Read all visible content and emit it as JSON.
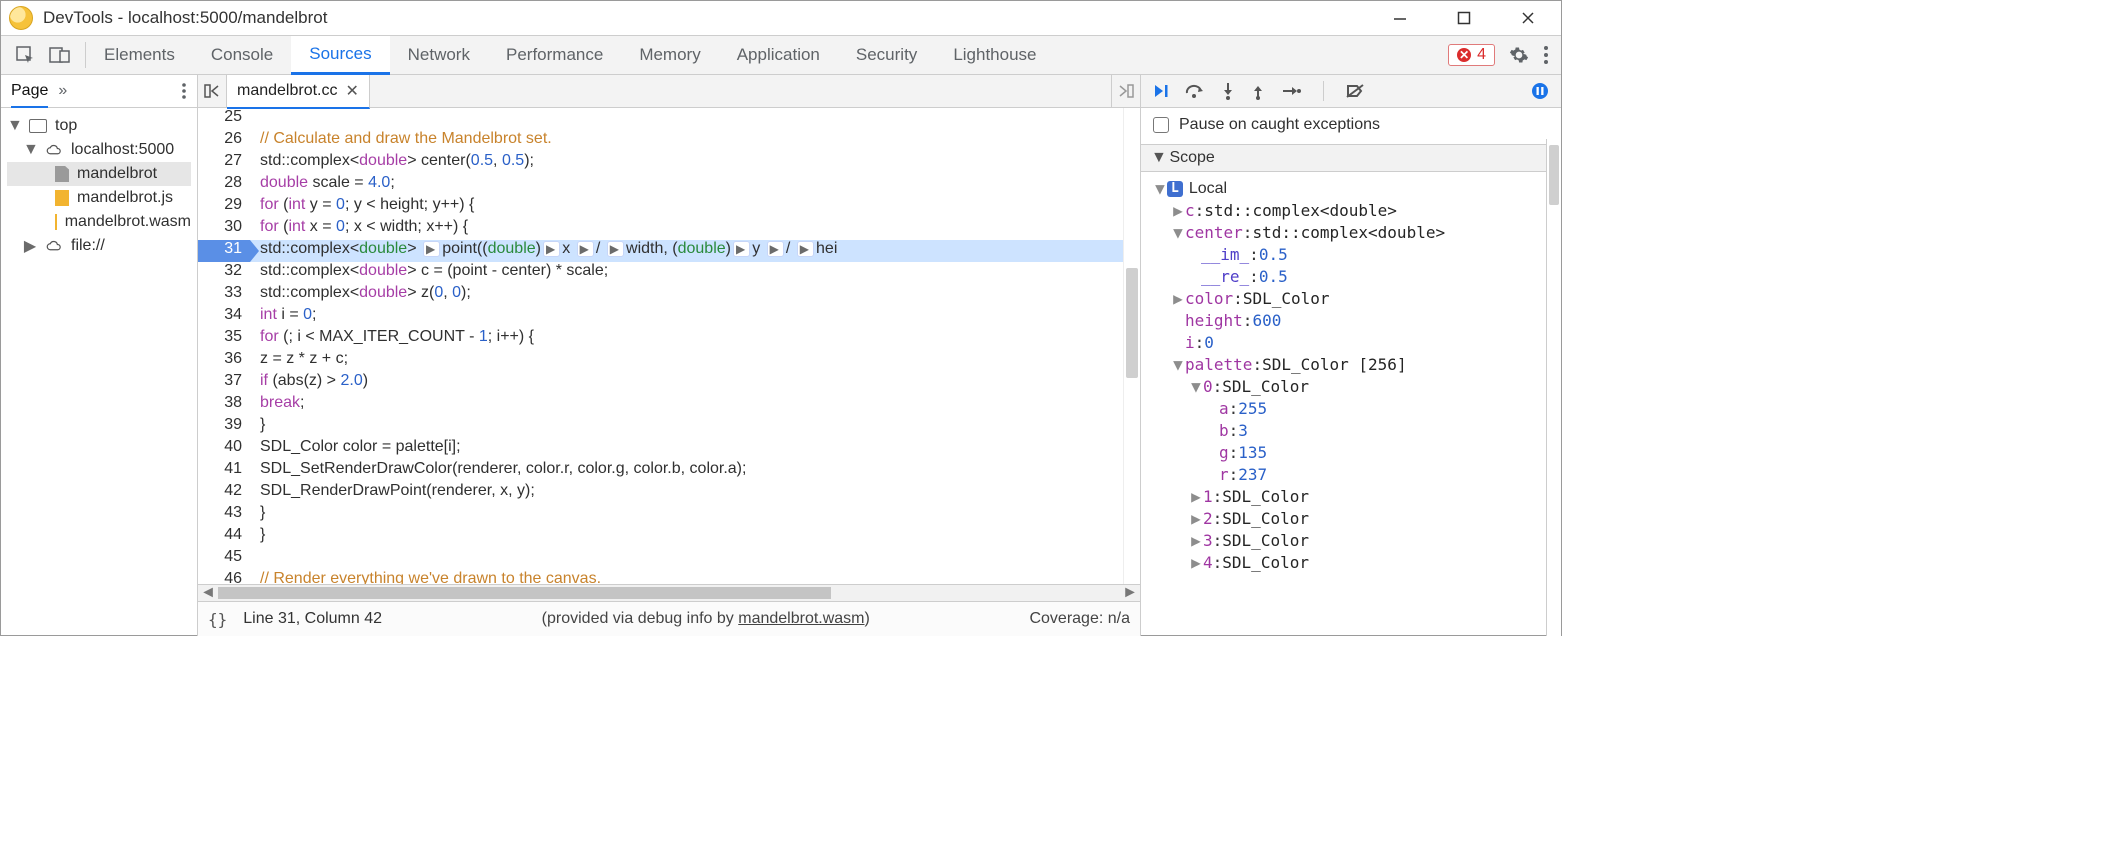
{
  "window": {
    "title": "DevTools - localhost:5000/mandelbrot"
  },
  "mainTabs": {
    "items": [
      "Elements",
      "Console",
      "Sources",
      "Network",
      "Performance",
      "Memory",
      "Application",
      "Security",
      "Lighthouse"
    ],
    "active": "Sources",
    "errorCount": "4"
  },
  "sidebar": {
    "section": "Page",
    "moreGlyph": "»",
    "tree": {
      "top": "top",
      "host": "localhost:5000",
      "files": [
        "mandelbrot",
        "mandelbrot.js",
        "mandelbrot.wasm"
      ],
      "fileScheme": "file://"
    }
  },
  "editor": {
    "tabName": "mandelbrot.cc",
    "startLine": 25,
    "highlightLine": 31,
    "lines": {
      "25": "",
      "26": "  // Calculate and draw the Mandelbrot set.",
      "27": "  std::complex<double> center(0.5, 0.5);",
      "28": "  double scale = 4.0;",
      "29": "  for (int y = 0; y < height; y++) {",
      "30": "    for (int x = 0; x < width; x++) {",
      "31": "      std::complex<double> point((double)x / width, (double)y / hei",
      "32": "      std::complex<double> c = (point - center) * scale;",
      "33": "      std::complex<double> z(0, 0);",
      "34": "      int i = 0;",
      "35": "      for (; i < MAX_ITER_COUNT - 1; i++) {",
      "36": "        z = z * z + c;",
      "37": "        if (abs(z) > 2.0)",
      "38": "          break;",
      "39": "      }",
      "40": "      SDL_Color color = palette[i];",
      "41": "      SDL_SetRenderDrawColor(renderer, color.r, color.g, color.b, color.a);",
      "42": "      SDL_RenderDrawPoint(renderer, x, y);",
      "43": "    }",
      "44": "  }",
      "45": "",
      "46": "  // Render everything we've drawn to the canvas.",
      "47": ""
    }
  },
  "status": {
    "pos": "Line 31, Column 42",
    "debugPrefix": "(provided via debug info by ",
    "debugLink": "mandelbrot.wasm",
    "debugSuffix": ")",
    "coverage": "Coverage: n/a"
  },
  "debug": {
    "pauseCaught": "Pause on caught exceptions",
    "scopeTitle": "Scope",
    "localTitle": "Local",
    "vars": {
      "c": {
        "name": "c",
        "type": "std::complex<double>"
      },
      "center": {
        "name": "center",
        "type": "std::complex<double>",
        "im": {
          "k": "__im_",
          "v": "0.5"
        },
        "re": {
          "k": "__re_",
          "v": "0.5"
        }
      },
      "color": {
        "name": "color",
        "type": "SDL_Color"
      },
      "height": {
        "name": "height",
        "value": "600"
      },
      "i": {
        "name": "i",
        "value": "0"
      },
      "palette": {
        "name": "palette",
        "type": "SDL_Color [256]",
        "entry0": {
          "idx": "0",
          "type": "SDL_Color",
          "a": {
            "k": "a",
            "v": "255"
          },
          "b": {
            "k": "b",
            "v": "3"
          },
          "g": {
            "k": "g",
            "v": "135"
          },
          "r": {
            "k": "r",
            "v": "237"
          }
        },
        "rest": [
          {
            "idx": "1",
            "type": "SDL_Color"
          },
          {
            "idx": "2",
            "type": "SDL_Color"
          },
          {
            "idx": "3",
            "type": "SDL_Color"
          },
          {
            "idx": "4",
            "type": "SDL_Color"
          }
        ]
      }
    }
  }
}
